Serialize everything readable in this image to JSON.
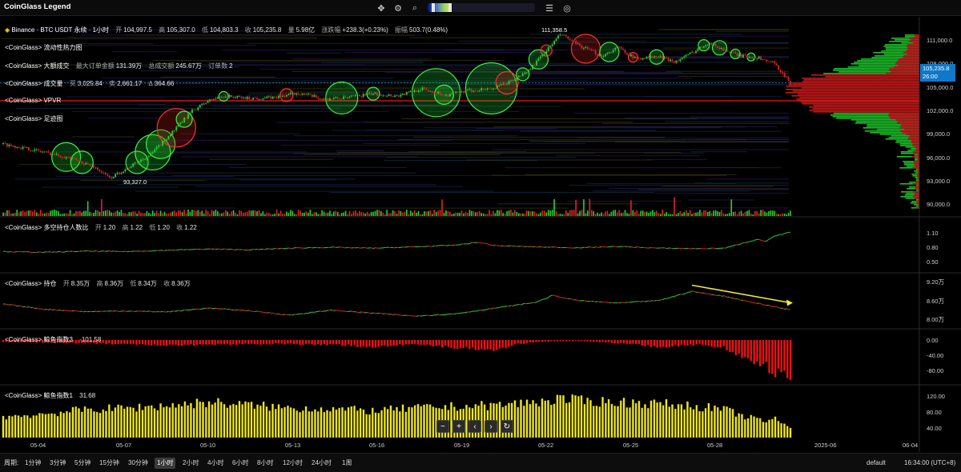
{
  "app": {
    "title": "CoinGlass Legend"
  },
  "toolbar": {
    "icons": [
      "crosshair-icon",
      "settings-gear-icon",
      "search-icon",
      "list-icon",
      "camera-icon"
    ]
  },
  "main_legend": {
    "exchange_icon": "binance-icon",
    "title": "Binance · BTC USDT 永续 · 1小时",
    "open_label": "开",
    "open": "104,997.5",
    "high_label": "高",
    "high": "105,307.0",
    "low_label": "低",
    "low": "104,803.3",
    "close_label": "收",
    "close": "105,235.8",
    "vol_label": "量",
    "vol": "5.98亿",
    "chg_label": "涨跌幅",
    "chg": "+238.3(+0.23%)",
    "amp_label": "振幅",
    "amp": "503.7(0.48%)"
  },
  "indicators": {
    "heatmap": "<CoinGlass> 流动性热力图",
    "large_orders": {
      "name": "<CoinGlass> 大额成交",
      "max_label": "最大订单金额",
      "max": "131.39万",
      "total_label": "总成交额",
      "total": "245.67万",
      "count_label": "订单数",
      "count": "2"
    },
    "volume": {
      "name": "<CoinGlass> 成交量",
      "buy_label": "买",
      "buy": "3,025.84",
      "sell_label": "卖",
      "sell": "2,661.17",
      "delta_label": "Δ",
      "delta": "364.66"
    },
    "vpvr": "<CoinGlass> VPVR",
    "footprint": "<CoinGlass> 足迹图"
  },
  "price_annotations": {
    "high": "111,358.5",
    "low": "93,327.0"
  },
  "current_price": {
    "value": "105,235.8",
    "countdown": "26:00"
  },
  "price_axis": [
    "111,000.0",
    "108,000.0",
    "105,000.0",
    "102,000.0",
    "99,000.0",
    "96,000.0",
    "93,000.0",
    "90,000.0"
  ],
  "panels": {
    "ls_ratio": {
      "name": "<CoinGlass> 多空持仓人数比",
      "open_label": "开",
      "open": "1.20",
      "high_label": "高",
      "high": "1.22",
      "low_label": "低",
      "low": "1.20",
      "close_label": "收",
      "close": "1.22",
      "axis": [
        "1.10",
        "0.80",
        "0.50"
      ]
    },
    "oi": {
      "name": "<CoinGlass> 持仓",
      "open_label": "开",
      "open": "8.35万",
      "high_label": "高",
      "high": "8.36万",
      "low_label": "低",
      "low": "8.34万",
      "close_label": "收",
      "close": "8.36万",
      "axis": [
        "9.20万",
        "8.60万",
        "8.00万"
      ]
    },
    "whale3": {
      "name": "<CoinGlass> 鲸鱼指数3",
      "value": "-101.58",
      "axis": [
        "0.00",
        "-40.00",
        "-80.00"
      ]
    },
    "whale1": {
      "name": "<CoinGlass> 鲸鱼指数1",
      "value": "31.68",
      "axis": [
        "120.00",
        "80.00",
        "40.00"
      ]
    }
  },
  "time_axis": [
    "05-04",
    "05-07",
    "05-10",
    "05-13",
    "05-16",
    "05-19",
    "05-22",
    "05-25",
    "05-28",
    "2025-06",
    "06-04"
  ],
  "nav_buttons": [
    "−",
    "+",
    "‹",
    "›",
    "↻"
  ],
  "bottom": {
    "period_label": "周期:",
    "periods": [
      "1分钟",
      "3分钟",
      "5分钟",
      "15分钟",
      "30分钟",
      "1小时",
      "2小时",
      "4小时",
      "6小时",
      "8小时",
      "12小时",
      "24小时",
      "1周"
    ],
    "active_period": "1小时",
    "theme": "default",
    "clock": "16:34:00 (UTC+8)"
  },
  "colors": {
    "up": "#26d431",
    "down": "#e52222",
    "whale1": "#f1ea1a",
    "trend": "#f2e63a",
    "price_box": "#0f78c8"
  },
  "chart_data": {
    "type": "candlestick",
    "x_range": [
      "05-03",
      "06-05"
    ],
    "price_ylim": [
      89000,
      112500
    ],
    "price_path": [
      [
        0,
        97600
      ],
      [
        4,
        96800
      ],
      [
        8,
        95900
      ],
      [
        11,
        94800
      ],
      [
        13,
        93327
      ],
      [
        15,
        94500
      ],
      [
        18,
        96300
      ],
      [
        21,
        99500
      ],
      [
        23,
        101700
      ],
      [
        25,
        103000
      ],
      [
        27,
        103600
      ],
      [
        30,
        103300
      ],
      [
        33,
        103400
      ],
      [
        36,
        104000
      ],
      [
        39,
        103200
      ],
      [
        42,
        103400
      ],
      [
        45,
        103900
      ],
      [
        48,
        103600
      ],
      [
        51,
        104500
      ],
      [
        54,
        103700
      ],
      [
        57,
        104300
      ],
      [
        60,
        104600
      ],
      [
        62,
        105500
      ],
      [
        64,
        106700
      ],
      [
        66,
        109000
      ],
      [
        68,
        111358
      ],
      [
        70,
        110000
      ],
      [
        73,
        108600
      ],
      [
        75,
        109700
      ],
      [
        77,
        108300
      ],
      [
        80,
        108500
      ],
      [
        82,
        107900
      ],
      [
        84,
        109000
      ],
      [
        86,
        110300
      ],
      [
        88,
        109300
      ],
      [
        90,
        108600
      ],
      [
        92,
        108400
      ],
      [
        94,
        107700
      ],
      [
        95,
        106500
      ],
      [
        96,
        105236
      ]
    ],
    "ls_ratio_path": [
      [
        0,
        0.76
      ],
      [
        5,
        0.74
      ],
      [
        10,
        0.77
      ],
      [
        15,
        0.76
      ],
      [
        20,
        0.79
      ],
      [
        25,
        0.82
      ],
      [
        30,
        0.8
      ],
      [
        35,
        0.84
      ],
      [
        40,
        0.86
      ],
      [
        45,
        0.84
      ],
      [
        50,
        0.87
      ],
      [
        55,
        0.91
      ],
      [
        58,
        0.98
      ],
      [
        60,
        0.9
      ],
      [
        65,
        0.87
      ],
      [
        70,
        0.85
      ],
      [
        75,
        0.88
      ],
      [
        80,
        0.84
      ],
      [
        85,
        0.83
      ],
      [
        88,
        0.84
      ],
      [
        90,
        0.95
      ],
      [
        92,
        1.05
      ],
      [
        93,
        1.0
      ],
      [
        94,
        1.12
      ],
      [
        96,
        1.22
      ]
    ],
    "oi_path": [
      [
        0,
        8.56
      ],
      [
        5,
        8.38
      ],
      [
        10,
        8.3
      ],
      [
        15,
        8.32
      ],
      [
        20,
        8.29
      ],
      [
        25,
        8.42
      ],
      [
        30,
        8.33
      ],
      [
        35,
        8.18
      ],
      [
        40,
        8.35
      ],
      [
        45,
        8.25
      ],
      [
        50,
        8.15
      ],
      [
        55,
        8.22
      ],
      [
        60,
        8.42
      ],
      [
        65,
        8.62
      ],
      [
        67,
        8.85
      ],
      [
        70,
        8.68
      ],
      [
        75,
        8.59
      ],
      [
        80,
        8.68
      ],
      [
        84,
        8.99
      ],
      [
        86,
        8.9
      ],
      [
        88,
        8.82
      ],
      [
        92,
        8.58
      ],
      [
        96,
        8.36
      ]
    ],
    "whale3_path": [
      [
        0,
        -5
      ],
      [
        10,
        -8
      ],
      [
        20,
        -15
      ],
      [
        30,
        -10
      ],
      [
        40,
        -12
      ],
      [
        45,
        -18
      ],
      [
        50,
        -10
      ],
      [
        55,
        -20
      ],
      [
        60,
        -25
      ],
      [
        63,
        -10
      ],
      [
        65,
        -5
      ],
      [
        70,
        -2
      ],
      [
        75,
        -8
      ],
      [
        80,
        -18
      ],
      [
        85,
        -12
      ],
      [
        88,
        -20
      ],
      [
        90,
        -40
      ],
      [
        93,
        -70
      ],
      [
        96,
        -101.58
      ]
    ],
    "whale1_path": [
      [
        0,
        70
      ],
      [
        5,
        80
      ],
      [
        10,
        95
      ],
      [
        15,
        100
      ],
      [
        20,
        108
      ],
      [
        25,
        120
      ],
      [
        30,
        110
      ],
      [
        35,
        100
      ],
      [
        40,
        98
      ],
      [
        45,
        90
      ],
      [
        50,
        100
      ],
      [
        55,
        105
      ],
      [
        60,
        110
      ],
      [
        65,
        120
      ],
      [
        68,
        132
      ],
      [
        70,
        125
      ],
      [
        75,
        120
      ],
      [
        80,
        115
      ],
      [
        85,
        105
      ],
      [
        88,
        95
      ],
      [
        90,
        75
      ],
      [
        93,
        55
      ],
      [
        94,
        65
      ],
      [
        96,
        31.68
      ]
    ],
    "trend_line": [
      [
        84,
        9.2
      ],
      [
        96,
        8.6
      ]
    ]
  }
}
